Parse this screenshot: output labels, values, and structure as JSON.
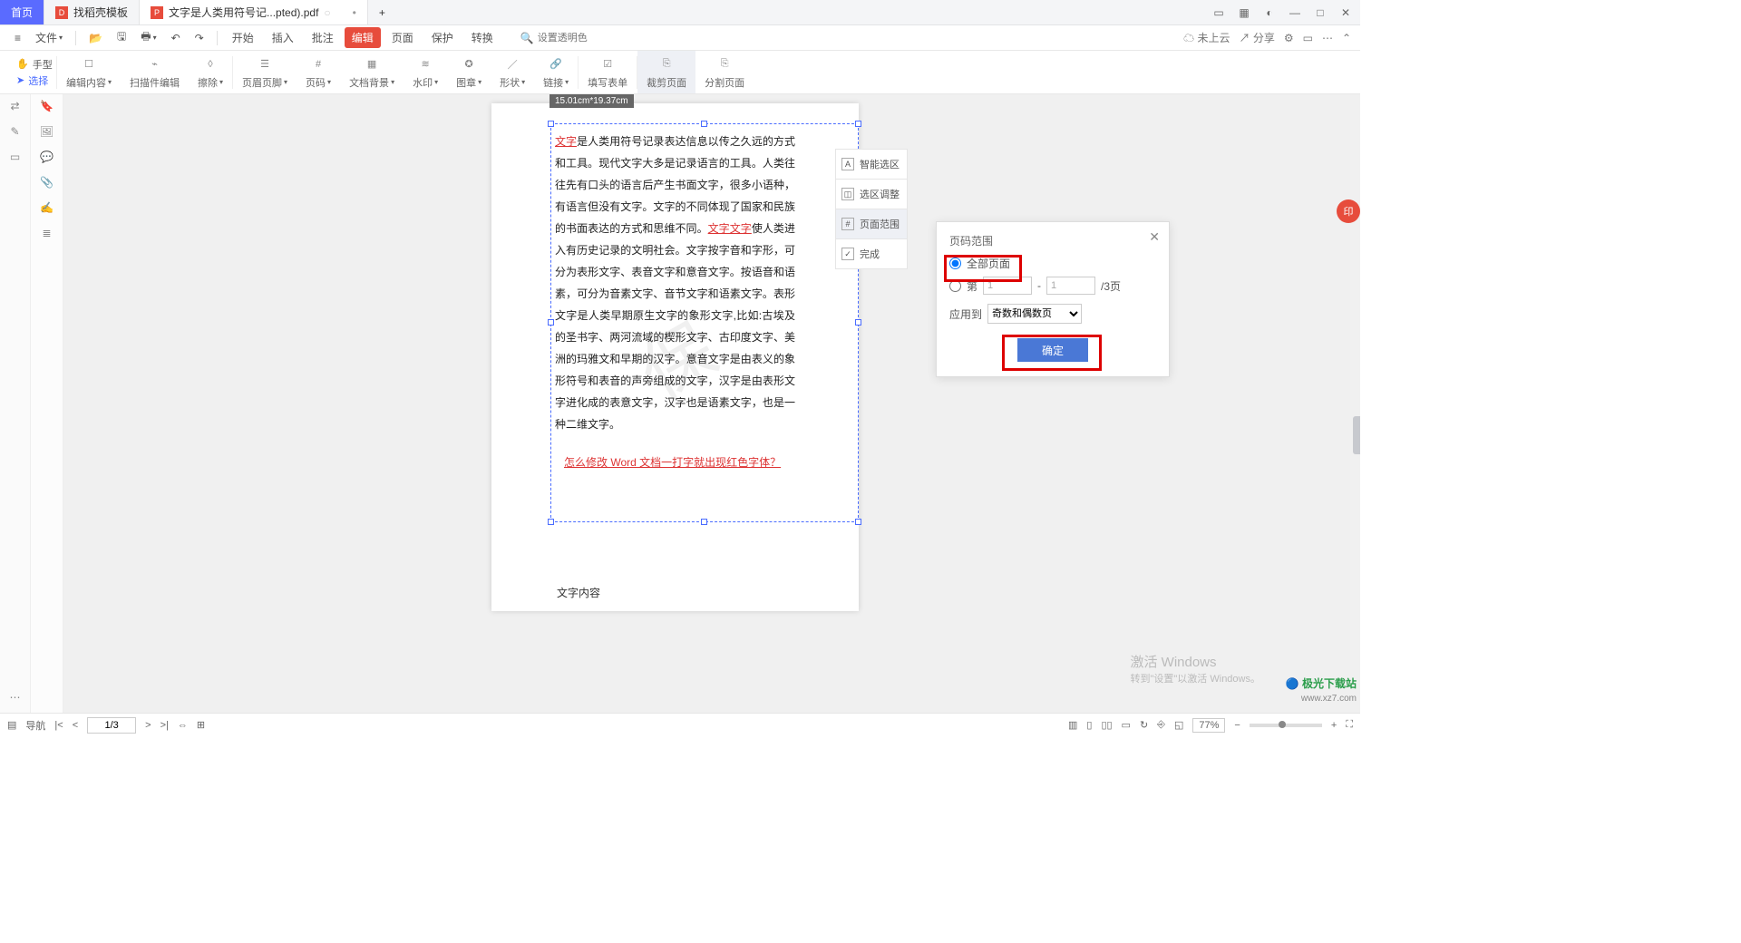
{
  "titlebar": {
    "tabs": [
      {
        "label": "首页"
      },
      {
        "label": "找稻壳模板"
      },
      {
        "label": "文字是人类用符号记...pted).pdf"
      }
    ],
    "add": "+"
  },
  "menubar": {
    "menu_icon": "≡",
    "file": "文件",
    "tabs": [
      "开始",
      "插入",
      "批注",
      "编辑",
      "页面",
      "保护",
      "转换"
    ],
    "active_tab": "编辑",
    "search_placeholder": "设置透明色",
    "right": {
      "cloud": "未上云",
      "share": "分享"
    }
  },
  "ribbon": {
    "hand": "手型",
    "select": "选择",
    "groups": [
      {
        "label": "编辑内容"
      },
      {
        "label": "扫描件编辑"
      },
      {
        "label": "擦除"
      },
      {
        "label": "页眉页脚"
      },
      {
        "label": "页码"
      },
      {
        "label": "文档背景"
      },
      {
        "label": "水印"
      },
      {
        "label": "图章"
      },
      {
        "label": "形状"
      },
      {
        "label": "链接"
      },
      {
        "label": "填写表单"
      },
      {
        "label": "裁剪页面"
      },
      {
        "label": "分割页面"
      }
    ],
    "active_group": "裁剪页面"
  },
  "crop_options": [
    "智能选区",
    "选区调整",
    "页面范围",
    "完成"
  ],
  "crop_active": "页面范围",
  "dim_label": "15.01cm*19.37cm",
  "document": {
    "red1": "文字",
    "body1": "是人类用符号记录表达信息以传之久远的方式和工具。现代文字大多是记录语言的工具。人类往往先有口头的语言后产生书面文字，很多小语种，有语言但没有文字。文字的不同体现了国家和民族的书面表达的方式和思维不同。",
    "red2": "文字文字",
    "body2": "使人类进入有历史记录的文明社会。文字按字音和字形，可分为表形文字、表音文字和意音文字。按语音和语素，可分为音素文字、音节文字和语素文字。表形文字是人类早期原生文字的象形文字,比如:古埃及的圣书字、两河流域的楔形文字、古印度文字、美洲的玛雅文和早期的汉字。意音文字是由表义的象形符号和表音的声旁组成的文字，汉字是由表形文字进化成的表意文字，汉字也是语素文字，也是一种二维文字。",
    "redlink": "怎么修改 Word 文档一打字就出现红色字体？",
    "footer": "文字内容",
    "watermark": "保"
  },
  "panel": {
    "title": "页码范围",
    "opt_all": "全部页面",
    "opt_range_prefix": "第",
    "range_from": "1",
    "range_sep": "-",
    "range_to": "1",
    "range_suffix": "/3页",
    "apply_label": "应用到",
    "apply_options": [
      "奇数和偶数页"
    ],
    "ok": "确定"
  },
  "status": {
    "nav": "导航",
    "page": "1/3",
    "zoom": "77%"
  },
  "activate": {
    "line1": "激活 Windows",
    "line2": "转到\"设置\"以激活 Windows。"
  },
  "site": {
    "name": "极光下载站",
    "url": "www.xz7.com"
  },
  "edge_badge": "印"
}
